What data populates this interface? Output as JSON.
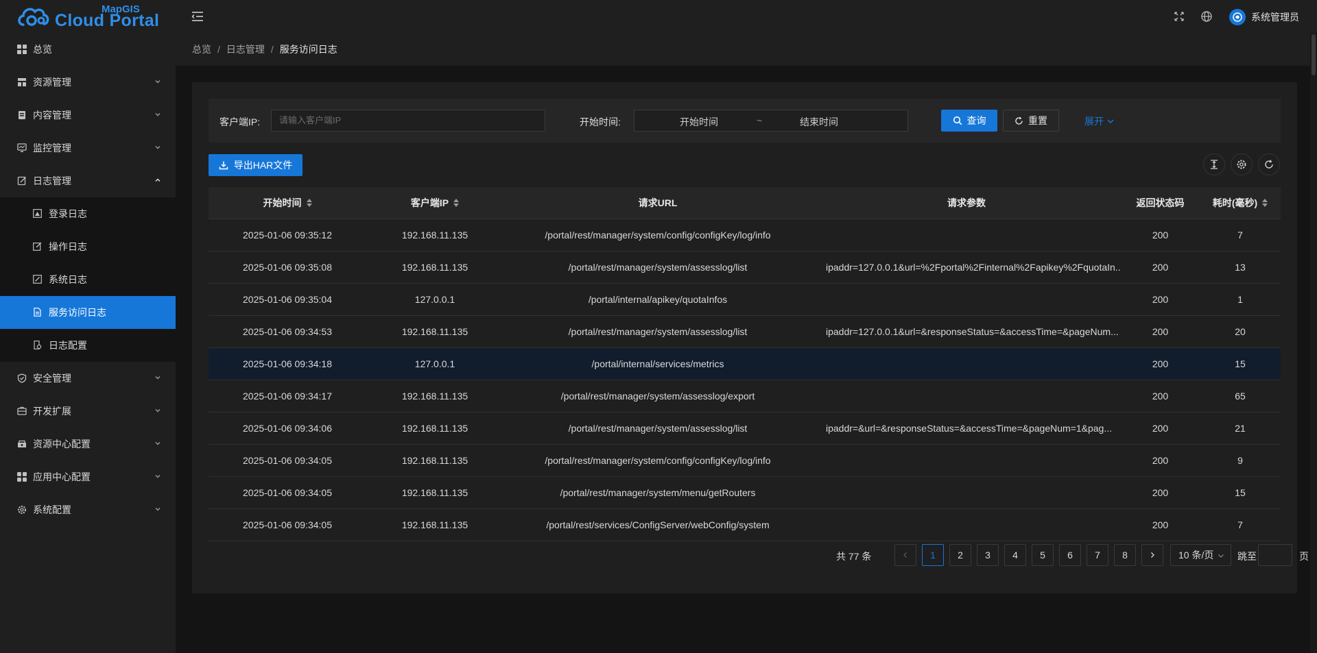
{
  "app": {
    "logo_small": "MapGIS",
    "logo_big": "Cloud Portal"
  },
  "sidebar": {
    "items": [
      {
        "label": "总览",
        "icon": "dashboard-icon"
      },
      {
        "label": "资源管理",
        "icon": "resource-icon"
      },
      {
        "label": "内容管理",
        "icon": "content-icon"
      },
      {
        "label": "监控管理",
        "icon": "monitor-icon"
      },
      {
        "label": "日志管理",
        "icon": "log-icon",
        "expanded": true
      },
      {
        "label": "安全管理",
        "icon": "shield-icon"
      },
      {
        "label": "开发扩展",
        "icon": "extension-icon"
      },
      {
        "label": "资源中心配置",
        "icon": "resource-center-icon"
      },
      {
        "label": "应用中心配置",
        "icon": "app-center-icon"
      },
      {
        "label": "系统配置",
        "icon": "gear-icon"
      }
    ],
    "log_submenu": [
      {
        "label": "登录日志"
      },
      {
        "label": "操作日志"
      },
      {
        "label": "系统日志"
      },
      {
        "label": "服务访问日志",
        "active": true
      },
      {
        "label": "日志配置"
      }
    ]
  },
  "header": {
    "username": "系统管理员"
  },
  "breadcrumb": [
    "总览",
    "日志管理",
    "服务访问日志"
  ],
  "filter": {
    "client_ip_label": "客户端IP:",
    "client_ip_placeholder": "请输入客户端IP",
    "time_label": "开始时间:",
    "range_start": "开始时间",
    "range_sep": "~",
    "range_end": "结束时间",
    "search_label": "查询",
    "reset_label": "重置",
    "expand_label": "展开"
  },
  "toolbar": {
    "export_label": "导出HAR文件"
  },
  "table": {
    "columns": [
      "开始时间",
      "客户端IP",
      "请求URL",
      "请求参数",
      "返回状态码",
      "耗时(毫秒)"
    ],
    "rows": [
      [
        "2025-01-06 09:35:12",
        "192.168.11.135",
        "/portal/rest/manager/system/config/configKey/log/info",
        "",
        "200",
        "7"
      ],
      [
        "2025-01-06 09:35:08",
        "192.168.11.135",
        "/portal/rest/manager/system/assesslog/list",
        "ipaddr=127.0.0.1&url=%2Fportal%2Finternal%2Fapikey%2FquotaIn...",
        "200",
        "13"
      ],
      [
        "2025-01-06 09:35:04",
        "127.0.0.1",
        "/portal/internal/apikey/quotaInfos",
        "",
        "200",
        "1"
      ],
      [
        "2025-01-06 09:34:53",
        "192.168.11.135",
        "/portal/rest/manager/system/assesslog/list",
        "ipaddr=127.0.0.1&url=&responseStatus=&accessTime=&pageNum...",
        "200",
        "20"
      ],
      [
        "2025-01-06 09:34:18",
        "127.0.0.1",
        "/portal/internal/services/metrics",
        "",
        "200",
        "15"
      ],
      [
        "2025-01-06 09:34:17",
        "192.168.11.135",
        "/portal/rest/manager/system/assesslog/export",
        "",
        "200",
        "65"
      ],
      [
        "2025-01-06 09:34:06",
        "192.168.11.135",
        "/portal/rest/manager/system/assesslog/list",
        "ipaddr=&url=&responseStatus=&accessTime=&pageNum=1&pag...",
        "200",
        "21"
      ],
      [
        "2025-01-06 09:34:05",
        "192.168.11.135",
        "/portal/rest/manager/system/config/configKey/log/info",
        "",
        "200",
        "9"
      ],
      [
        "2025-01-06 09:34:05",
        "192.168.11.135",
        "/portal/rest/manager/system/menu/getRouters",
        "",
        "200",
        "15"
      ],
      [
        "2025-01-06 09:34:05",
        "192.168.11.135",
        "/portal/rest/services/ConfigServer/webConfig/system",
        "",
        "200",
        "7"
      ]
    ],
    "highlighted_row": 4
  },
  "pagination": {
    "total_text": "共 77 条",
    "pages": [
      "1",
      "2",
      "3",
      "4",
      "5",
      "6",
      "7",
      "8"
    ],
    "current": "1",
    "page_size": "10 条/页",
    "jump_label": "跳至",
    "page_suffix": "页"
  },
  "colors": {
    "accent": "#1677d9",
    "sidebar_bg": "#1f1f1f",
    "page_bg": "#141414",
    "highlight_row": "#111d2c"
  }
}
